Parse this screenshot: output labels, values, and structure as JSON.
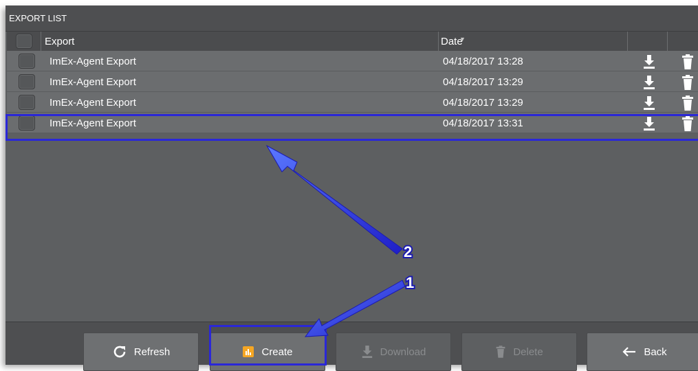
{
  "window": {
    "title": "EXPORT LIST"
  },
  "table": {
    "columns": {
      "export": "Export",
      "date": "Date"
    },
    "rows": [
      {
        "name": "ImEx-Agent Export",
        "date": "04/18/2017 13:28"
      },
      {
        "name": "ImEx-Agent Export",
        "date": "04/18/2017 13:29"
      },
      {
        "name": "ImEx-Agent Export",
        "date": "04/18/2017 13:29"
      },
      {
        "name": "ImEx-Agent Export",
        "date": "04/18/2017 13:31"
      }
    ]
  },
  "buttons": {
    "refresh": "Refresh",
    "create": "Create",
    "download": "Download",
    "delete": "Delete",
    "back": "Back"
  },
  "annotations": {
    "step1": "1",
    "step2": "2"
  },
  "icons": [
    "refresh-icon",
    "create-icon",
    "download-icon",
    "delete-icon",
    "back-arrow-icon",
    "sort-arrow-icon",
    "trash-icon"
  ],
  "colors": {
    "highlight": "#2a27d8",
    "create_icon": "#f5a623",
    "panel": "#5d5f61"
  }
}
